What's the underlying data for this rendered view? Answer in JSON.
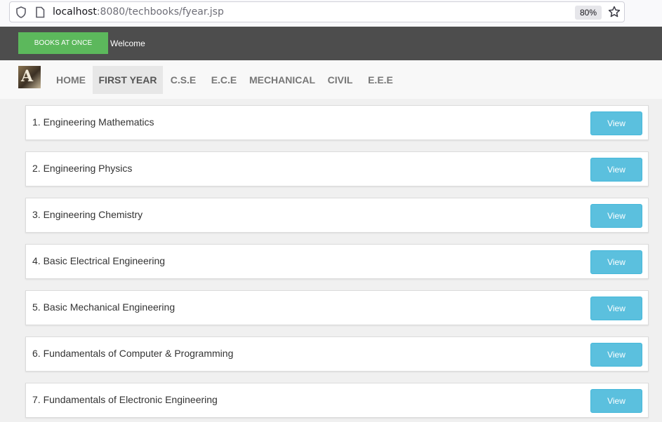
{
  "browser": {
    "url_host": "localhost",
    "url_rest": ":8080/techbooks/fyear.jsp",
    "zoom": "80%"
  },
  "header": {
    "brand_label": "BOOKS AT ONCE",
    "welcome": "Welcome"
  },
  "nav": {
    "items": [
      {
        "label": "HOME"
      },
      {
        "label": "FIRST YEAR"
      },
      {
        "label": "C.S.E"
      },
      {
        "label": "E.C.E"
      },
      {
        "label": "MECHANICAL"
      },
      {
        "label": "CIVIL"
      },
      {
        "label": "E.E.E"
      }
    ]
  },
  "books": [
    {
      "title": "1. Engineering Mathematics",
      "button": "View"
    },
    {
      "title": "2. Engineering Physics",
      "button": "View"
    },
    {
      "title": "3. Engineering Chemistry",
      "button": "View"
    },
    {
      "title": "4. Basic Electrical Engineering",
      "button": "View"
    },
    {
      "title": "5. Basic Mechanical Engineering",
      "button": "View"
    },
    {
      "title": "6. Fundamentals of Computer & Programming",
      "button": "View"
    },
    {
      "title": "7. Fundamentals of Electronic Engineering",
      "button": "View"
    }
  ]
}
